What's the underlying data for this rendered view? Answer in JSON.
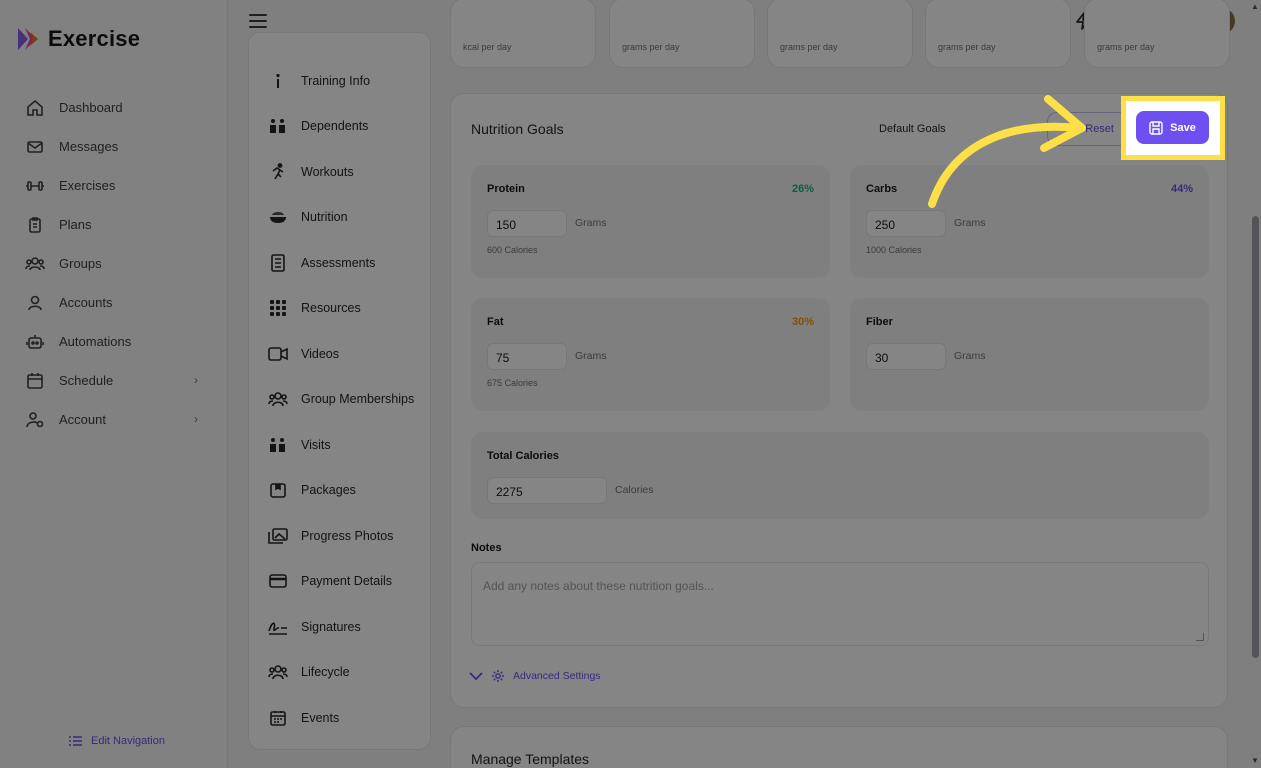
{
  "app": {
    "name": "Exercise"
  },
  "sidebar": {
    "items": [
      {
        "label": "Dashboard",
        "icon": "home-icon"
      },
      {
        "label": "Messages",
        "icon": "mail-icon"
      },
      {
        "label": "Exercises",
        "icon": "dumbbell-icon"
      },
      {
        "label": "Plans",
        "icon": "clipboard-icon"
      },
      {
        "label": "Groups",
        "icon": "users-icon"
      },
      {
        "label": "Accounts",
        "icon": "user-icon"
      },
      {
        "label": "Automations",
        "icon": "robot-icon"
      },
      {
        "label": "Schedule",
        "icon": "calendar-icon"
      },
      {
        "label": "Account",
        "icon": "user-gear-icon"
      }
    ],
    "edit_nav": "Edit Navigation"
  },
  "submenu": {
    "items": [
      {
        "label": "Training Info",
        "icon": "info-icon"
      },
      {
        "label": "Dependents",
        "icon": "people-icon"
      },
      {
        "label": "Workouts",
        "icon": "running-icon"
      },
      {
        "label": "Nutrition",
        "icon": "bowl-icon"
      },
      {
        "label": "Assessments",
        "icon": "checklist-icon"
      },
      {
        "label": "Resources",
        "icon": "grid-icon"
      },
      {
        "label": "Videos",
        "icon": "video-icon"
      },
      {
        "label": "Group Memberships",
        "icon": "users-icon"
      },
      {
        "label": "Visits",
        "icon": "people-icon"
      },
      {
        "label": "Packages",
        "icon": "package-icon"
      },
      {
        "label": "Progress Photos",
        "icon": "photos-icon"
      },
      {
        "label": "Payment Details",
        "icon": "card-icon"
      },
      {
        "label": "Signatures",
        "icon": "signature-icon"
      },
      {
        "label": "Lifecycle",
        "icon": "users-icon"
      },
      {
        "label": "Events",
        "icon": "calendar-icon"
      }
    ]
  },
  "summary": [
    {
      "label": "kcal per day"
    },
    {
      "label": "grams per day"
    },
    {
      "label": "grams per day"
    },
    {
      "label": "grams per day"
    },
    {
      "label": "grams per day"
    }
  ],
  "nutrition": {
    "title": "Nutrition Goals",
    "goal_select": "Default Goals",
    "reset_label": "Reset",
    "save_label": "Save",
    "protein": {
      "name": "Protein",
      "pct": "26%",
      "value": "150",
      "unit": "Grams",
      "calories": "600 Calories",
      "color": "#10b981"
    },
    "carbs": {
      "name": "Carbs",
      "pct": "44%",
      "value": "250",
      "unit": "Grams",
      "calories": "1000 Calories",
      "color": "#6d4ff2"
    },
    "fat": {
      "name": "Fat",
      "pct": "30%",
      "value": "75",
      "unit": "Grams",
      "calories": "675 Calories",
      "color": "#f59e0b"
    },
    "fiber": {
      "name": "Fiber",
      "value": "30",
      "unit": "Grams"
    },
    "total": {
      "name": "Total Calories",
      "value": "2275",
      "unit": "Calories"
    },
    "notes_label": "Notes",
    "notes_placeholder": "Add any notes about these nutrition goals...",
    "advanced": "Advanced Settings"
  },
  "manage": {
    "title": "Manage Templates"
  },
  "colors": {
    "accent": "#6d4ff2",
    "highlight": "#fde047"
  }
}
